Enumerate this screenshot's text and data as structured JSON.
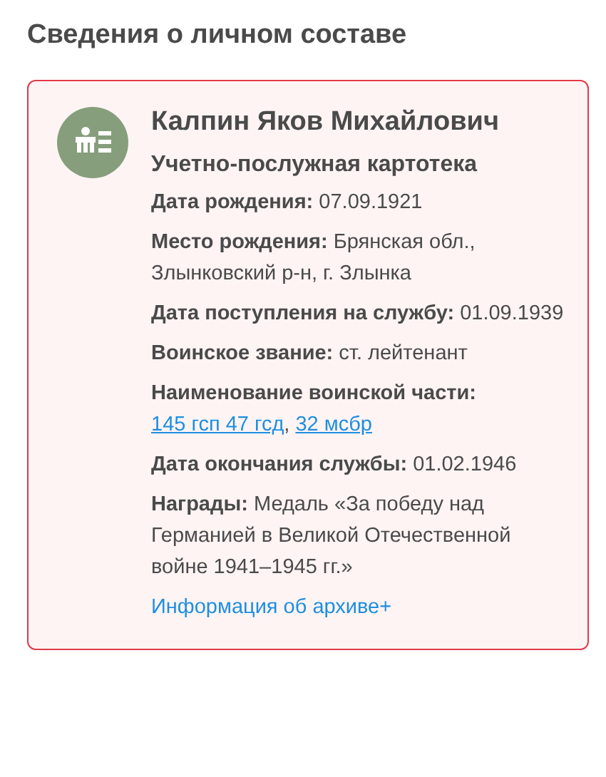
{
  "heading": "Сведения о личном составе",
  "card": {
    "name": "Калпин Яков Михайлович",
    "subtitle": "Учетно-послужная картотека",
    "fields": [
      {
        "kind": "text",
        "label": "Дата рождения:",
        "value": "07.09.1921"
      },
      {
        "kind": "wrapped",
        "label": "Место рождения:",
        "value_lines": [
          "Брянская обл.,",
          "Злынковский р-н, г. Злынка"
        ]
      },
      {
        "kind": "text",
        "label": "Дата поступления на службу:",
        "value": "01.09.1939"
      },
      {
        "kind": "text",
        "label": "Воинское звание:",
        "value": "ст. лейтенант"
      },
      {
        "kind": "links",
        "label": "Наименование воинской части:",
        "links": [
          "145 гсп 47 гсд",
          "32 мсбр"
        ],
        "separator": ","
      },
      {
        "kind": "text",
        "label": "Дата окончания службы:",
        "value": "01.02.1946"
      },
      {
        "kind": "wrapped",
        "label": "Награды:",
        "value_lines": [
          "Медаль «За победу над",
          "Германией в Великой Отечественной",
          "войне 1941–1945 гг.»"
        ]
      }
    ],
    "archive_link": "Информация об архиве+"
  }
}
